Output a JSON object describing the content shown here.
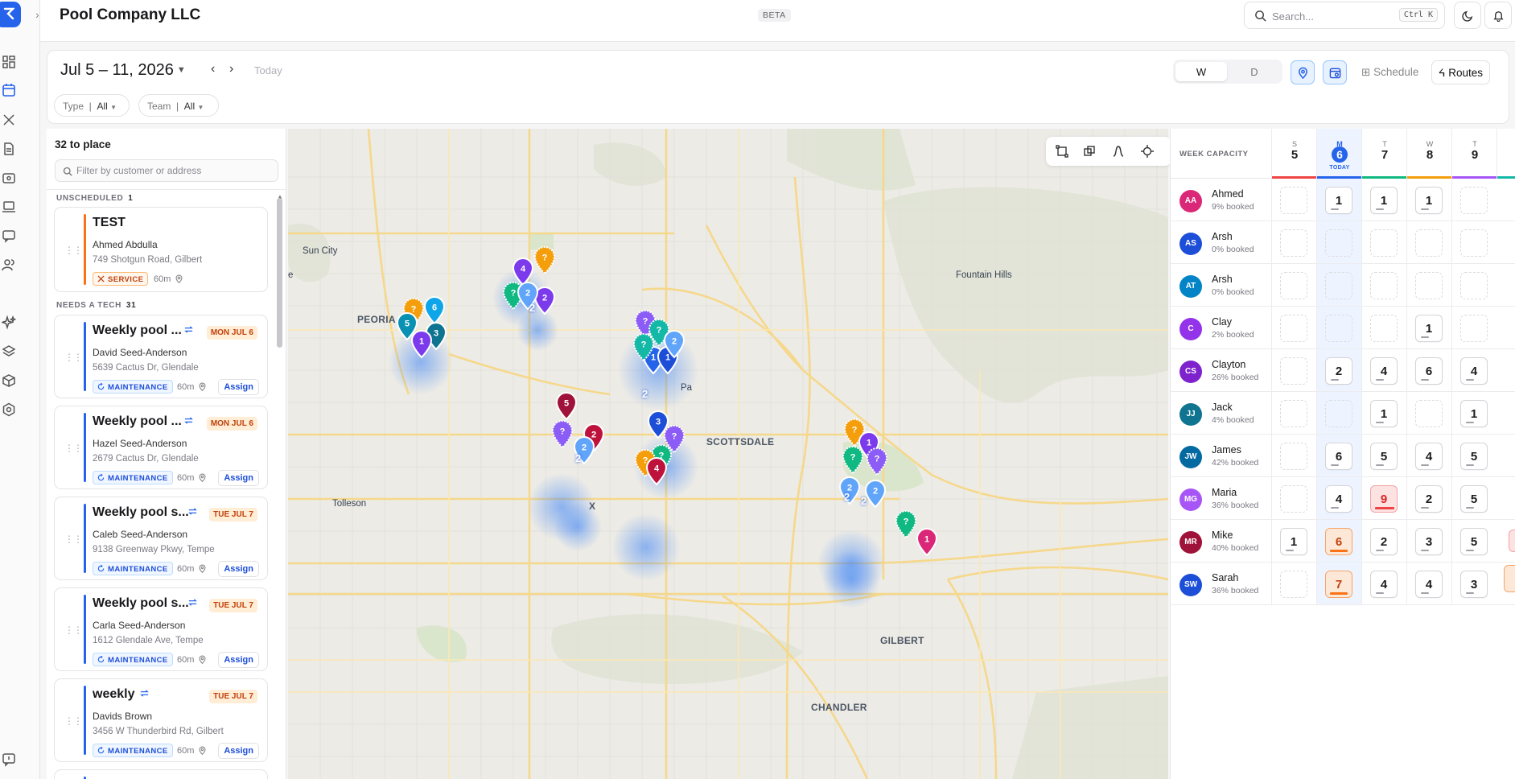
{
  "header": {
    "company": "Pool Company LLC",
    "beta": "BETA",
    "search_placeholder": "Search...",
    "search_shortcut": "Ctrl K"
  },
  "toolbar": {
    "date_range": "Jul 5 – 11, 2026",
    "today_label": "Today",
    "filters": [
      {
        "label": "Type",
        "value": "All"
      },
      {
        "label": "Team",
        "value": "All"
      }
    ],
    "view_toggle": [
      "W",
      "D"
    ],
    "selected_toggle": "W",
    "schedule_label": "Schedule",
    "routes_label": "Routes"
  },
  "panel": {
    "count_label": "32 to place",
    "filter_placeholder": "Filter by customer or address",
    "unscheduled_label": "UNSCHEDULED",
    "unscheduled_count": "1",
    "needs_tech_label": "NEEDS A TECH",
    "needs_tech_count": "31",
    "assign_label": "Assign",
    "unscheduled": {
      "title": "TEST",
      "customer": "Ahmed Abdulla",
      "address": "749 Shotgun Road, Gilbert",
      "tag": "SERVICE",
      "duration": "60m"
    },
    "jobs": [
      {
        "title": "Weekly pool ...",
        "day": "MON JUL 6",
        "customer": "David Seed-Anderson",
        "address": "5639 Cactus Dr, Glendale",
        "tag": "MAINTENANCE",
        "duration": "60m"
      },
      {
        "title": "Weekly pool ...",
        "day": "MON JUL 6",
        "customer": "Hazel Seed-Anderson",
        "address": "2679 Cactus Dr, Glendale",
        "tag": "MAINTENANCE",
        "duration": "60m"
      },
      {
        "title": "Weekly pool s...",
        "day": "TUE JUL 7",
        "customer": "Caleb Seed-Anderson",
        "address": "9138 Greenway Pkwy, Tempe",
        "tag": "MAINTENANCE",
        "duration": "60m"
      },
      {
        "title": "Weekly pool s...",
        "day": "TUE JUL 7",
        "customer": "Carla Seed-Anderson",
        "address": "1612 Glendale Ave, Tempe",
        "tag": "MAINTENANCE",
        "duration": "60m"
      },
      {
        "title": "weekly",
        "day": "TUE JUL 7",
        "customer": "Davids Brown",
        "address": "3456 W Thunderbird Rd, Gilbert",
        "tag": "MAINTENANCE",
        "duration": "60m"
      }
    ]
  },
  "map": {
    "places": [
      "Sun City",
      "PEORIA",
      "Fountain Hills",
      "Tolleson",
      "CHANDLER",
      "GILBERT",
      "SCOTTSDALE",
      "Pa",
      "e",
      "X"
    ],
    "clusters": [
      {
        "label": "4",
        "color": "#7c3aed"
      },
      {
        "label": "?",
        "color": "#f59e0b"
      },
      {
        "label": "2",
        "color": "#7c3aed"
      },
      {
        "label": "?",
        "color": "#10b981"
      },
      {
        "label": "2",
        "color": "#60a5fa"
      },
      {
        "label": "?",
        "color": "#f59e0b"
      },
      {
        "label": "6",
        "color": "#0ea5e9"
      },
      {
        "label": "5",
        "color": "#0891b2"
      },
      {
        "label": "3",
        "color": "#0e7490"
      },
      {
        "label": "1",
        "color": "#7c3aed"
      },
      {
        "label": "?",
        "color": "#8b5cf6"
      },
      {
        "label": "?",
        "color": "#14b8a6"
      },
      {
        "label": "1",
        "color": "#2563eb"
      },
      {
        "label": "1",
        "color": "#1d4ed8"
      },
      {
        "label": "?",
        "color": "#14b8a6"
      },
      {
        "label": "2",
        "color": "#60a5fa"
      },
      {
        "label": "5",
        "color": "#9f1239"
      },
      {
        "label": "?",
        "color": "#8b5cf6"
      },
      {
        "label": "2",
        "color": "#be123c"
      },
      {
        "label": "2",
        "color": "#60a5fa"
      },
      {
        "label": "3",
        "color": "#1d4ed8"
      },
      {
        "label": "?",
        "color": "#8b5cf6"
      },
      {
        "label": "?",
        "color": "#10b981"
      },
      {
        "label": "?",
        "color": "#f59e0b"
      },
      {
        "label": "4",
        "color": "#be123c"
      },
      {
        "label": "?",
        "color": "#f59e0b"
      },
      {
        "label": "1",
        "color": "#7c3aed"
      },
      {
        "label": "?",
        "color": "#10b981"
      },
      {
        "label": "?",
        "color": "#8b5cf6"
      },
      {
        "label": "2",
        "color": "#60a5fa"
      },
      {
        "label": "2",
        "color": "#60a5fa"
      },
      {
        "label": "?",
        "color": "#10b981"
      },
      {
        "label": "1",
        "color": "#db2777"
      }
    ]
  },
  "capacity": {
    "label": "WEEK CAPACITY",
    "days": [
      {
        "dow": "S",
        "num": "5",
        "color": "#ef4444"
      },
      {
        "dow": "M",
        "num": "6",
        "color": "#2563eb",
        "today": "TODAY"
      },
      {
        "dow": "T",
        "num": "7",
        "color": "#10b981"
      },
      {
        "dow": "W",
        "num": "8",
        "color": "#f59e0b"
      },
      {
        "dow": "T",
        "num": "9",
        "color": "#a855f7"
      }
    ],
    "techs": [
      {
        "initials": "AA",
        "name": "Ahmed",
        "booked": "9% booked",
        "color": "#db2777",
        "cells": [
          "",
          "1",
          "1",
          "1",
          ""
        ]
      },
      {
        "initials": "AS",
        "name": "Arsh",
        "booked": "0% booked",
        "color": "#1d4ed8",
        "cells": [
          "",
          "",
          "",
          "",
          ""
        ]
      },
      {
        "initials": "AT",
        "name": "Arsh",
        "booked": "0% booked",
        "color": "#0284c7",
        "cells": [
          "",
          "",
          "",
          "",
          ""
        ]
      },
      {
        "initials": "C",
        "name": "Clay",
        "booked": "2% booked",
        "color": "#9333ea",
        "cells": [
          "",
          "",
          "",
          "1",
          ""
        ]
      },
      {
        "initials": "CS",
        "name": "Clayton",
        "booked": "26% booked",
        "color": "#7e22ce",
        "cells": [
          "",
          "2",
          "4",
          "6",
          "4"
        ]
      },
      {
        "initials": "JJ",
        "name": "Jack",
        "booked": "4% booked",
        "color": "#0e7490",
        "cells": [
          "",
          "",
          "1",
          "",
          "1"
        ]
      },
      {
        "initials": "JW",
        "name": "James",
        "booked": "42% booked",
        "color": "#0369a1",
        "cells": [
          "",
          "6",
          "5",
          "4",
          "5"
        ]
      },
      {
        "initials": "MG",
        "name": "Maria",
        "booked": "36% booked",
        "color": "#a855f7",
        "cells": [
          "",
          "4",
          "9",
          "2",
          "5"
        ]
      },
      {
        "initials": "MR",
        "name": "Mike",
        "booked": "40% booked",
        "color": "#9f1239",
        "cells": [
          "1",
          "6",
          "2",
          "3",
          "5"
        ]
      },
      {
        "initials": "SW",
        "name": "Sarah",
        "booked": "36% booked",
        "color": "#1d4ed8",
        "cells": [
          "",
          "7",
          "4",
          "4",
          "3"
        ]
      }
    ],
    "flags": {
      "warn": [
        "8-1",
        "9-1"
      ],
      "over": [
        "7-2"
      ]
    }
  }
}
